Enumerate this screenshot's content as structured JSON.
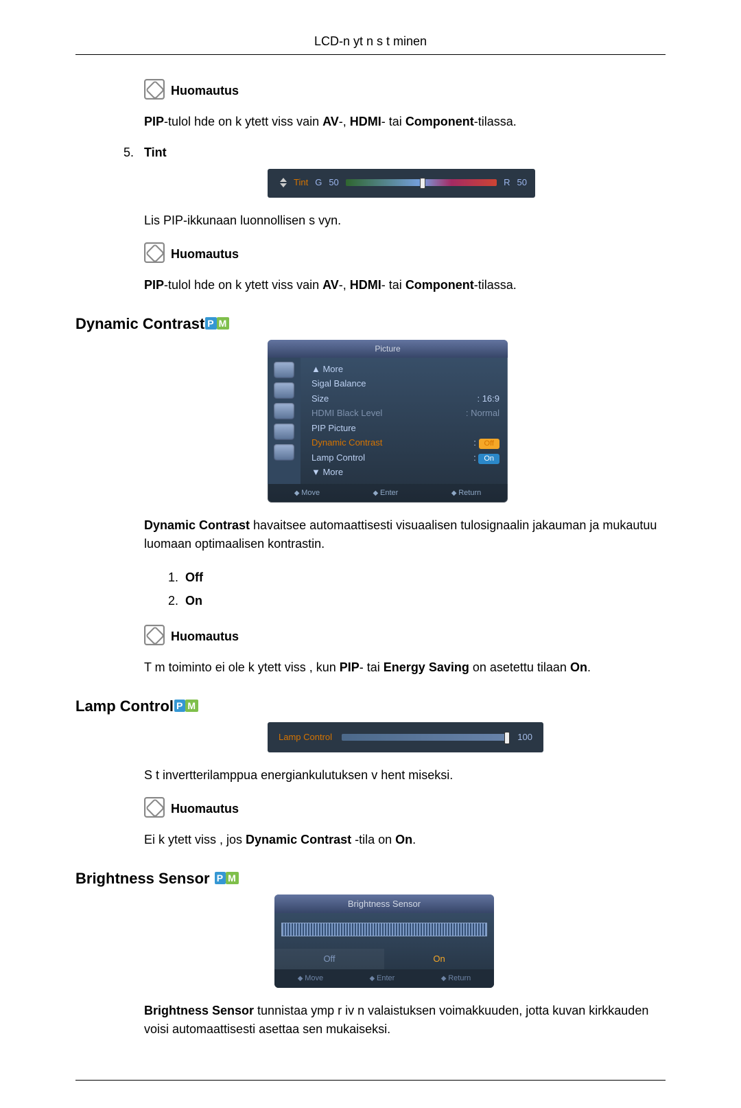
{
  "header": {
    "title": "LCD-n yt n s t minen"
  },
  "note_label": "Huomautus",
  "pip_sentence": {
    "pip": "PIP",
    "text1": "-tulol hde on k ytett viss  vain      ",
    "av": "AV",
    "dash1": "-, ",
    "hdmi": "HDMI",
    "dash2": "- tai ",
    "comp": "Component",
    "text2": "-tilassa."
  },
  "tint": {
    "number": "5.",
    "label": "Tint",
    "osd": {
      "label": "Tint",
      "g": "G",
      "gval": "50",
      "r": "R",
      "rval": "50"
    },
    "desc": "Lis   PIP-ikkunaan luonnollisen s vyn."
  },
  "dynamic": {
    "heading": "Dynamic Contrast",
    "menu": {
      "title": "Picture",
      "more_up": "▲ More",
      "rows": [
        {
          "label": "Sigal Balance",
          "value": ""
        },
        {
          "label": "Size",
          "value": ": 16:9"
        },
        {
          "label": "HDMI Black Level",
          "value": ": Normal",
          "dim": true
        },
        {
          "label": "PIP Picture",
          "value": ""
        },
        {
          "label": "Dynamic Contrast",
          "pill": "Off",
          "selected": true
        },
        {
          "label": "Lamp Control",
          "pill_blue": "On"
        }
      ],
      "more_down": "▼ More",
      "footer": [
        "Move",
        "Enter",
        "Return"
      ]
    },
    "para1a": "Dynamic Contrast",
    "para1b": " havaitsee automaattisesti visuaalisen tulosignaalin jakauman ja mukautuu luomaan optimaalisen kontrastin.",
    "options": [
      {
        "n": "1.",
        "v": "Off"
      },
      {
        "n": "2.",
        "v": "On"
      }
    ],
    "note2a": "T m  toiminto ei ole k ytett viss , kun      ",
    "note2b": "PIP",
    "note2c": "- tai ",
    "note2d": "Energy Saving",
    "note2e": " on asetettu tilaan ",
    "note2f": "On",
    "note2g": "."
  },
  "lamp": {
    "heading": "Lamp Control",
    "osd": {
      "label": "Lamp Control",
      "val": "100"
    },
    "desc": "S t  invertterilamppua energiankulutuksen v hent miseksi.",
    "note_a": "Ei k ytett viss , jos ",
    "note_b": "Dynamic Contrast",
    "note_c": " -tila on ",
    "note_d": "On",
    "note_e": "."
  },
  "bs": {
    "heading": "Brightness Sensor",
    "osd": {
      "title": "Brightness Sensor",
      "off": "Off",
      "on": "On",
      "footer": [
        "Move",
        "Enter",
        "Return"
      ]
    },
    "para_a": "Brightness Sensor",
    "para_b": " tunnistaa ymp r iv n valaistuksen voimakkuuden, jotta kuvan kirkkauden voisi automaattisesti asettaa sen mukaiseksi."
  }
}
